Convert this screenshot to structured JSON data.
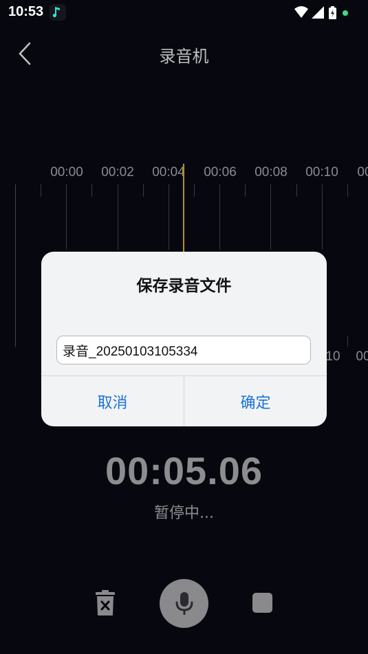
{
  "status_bar": {
    "time": "10:53",
    "icons": [
      "music-note-icon",
      "wifi-icon",
      "signal-icon",
      "battery-charging-icon",
      "notification-dot-icon"
    ],
    "accent_music": "#2ee6c8",
    "dot_color": "#3ddc84"
  },
  "header": {
    "title": "录音机",
    "back_icon": "chevron-left-icon"
  },
  "timeline": {
    "labels_top": [
      "00:00",
      "00:02",
      "00:04",
      "00:06",
      "00:08",
      "00:10",
      "00"
    ],
    "labels_bottom_visible": [
      "10",
      "00"
    ],
    "playhead_color": "#b8921e"
  },
  "dialog": {
    "title": "保存录音文件",
    "filename_value": "录音_20250103105334",
    "cancel_label": "取消",
    "confirm_label": "确定",
    "button_color": "#1a73d9"
  },
  "recorder": {
    "elapsed": "00:05.06",
    "state_text": "暂停中..."
  },
  "controls": {
    "delete_icon": "trash-x-icon",
    "record_icon": "microphone-icon",
    "stop_icon": "stop-square-icon"
  }
}
